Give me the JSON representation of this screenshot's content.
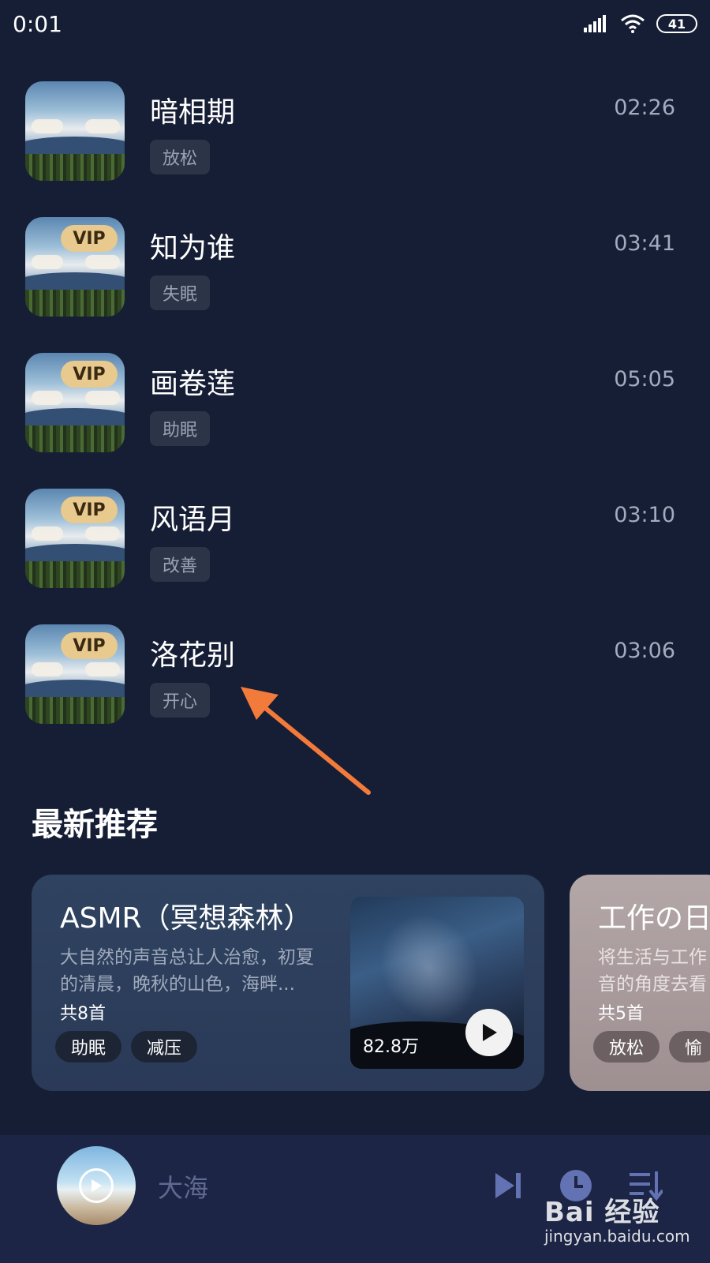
{
  "status_bar": {
    "time": "0:01",
    "battery": "41"
  },
  "tracks": [
    {
      "title": "暗相期",
      "tag": "放松",
      "duration": "02:26",
      "vip": false
    },
    {
      "title": "知为谁",
      "tag": "失眠",
      "duration": "03:41",
      "vip": true
    },
    {
      "title": "画卷莲",
      "tag": "助眠",
      "duration": "05:05",
      "vip": true
    },
    {
      "title": "风语月",
      "tag": "改善",
      "duration": "03:10",
      "vip": true
    },
    {
      "title": "洛花别",
      "tag": "开心",
      "duration": "03:06",
      "vip": true
    }
  ],
  "vip_label": "VIP",
  "section": {
    "title": "最新推荐"
  },
  "cards": [
    {
      "title": "ASMR（冥想森林）",
      "desc": "大自然的声音总让人治愈，初夏的清晨，晚秋的山色，海畔...",
      "count": "共8首",
      "tags": [
        "助眠",
        "减压"
      ],
      "plays": "82.8万"
    },
    {
      "title": "工作の日",
      "desc_line1": "将生活与工作",
      "desc_line2": "音的角度去看",
      "count": "共5首",
      "tags": [
        "放松",
        "愉"
      ]
    }
  ],
  "player": {
    "title": "大海"
  },
  "watermark": {
    "logo": "Bai 经验",
    "sub": "jingyan.baidu.com"
  },
  "colors": {
    "background": "#161e35",
    "vip": "#e8c98e",
    "arrow": "#f27a3b"
  }
}
